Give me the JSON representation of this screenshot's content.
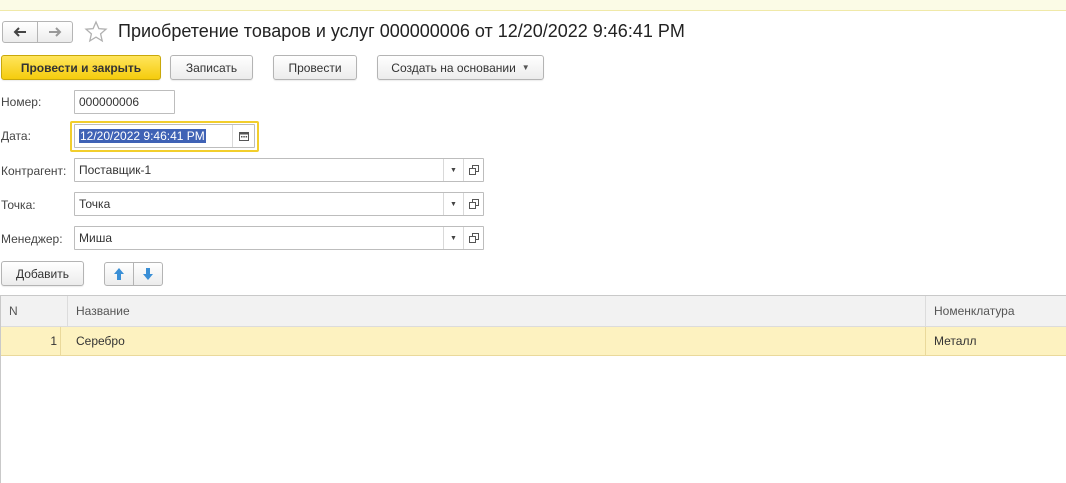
{
  "window": {
    "title": "Приобретение товаров и услуг 000000006 от 12/20/2022 9:46:41 PM"
  },
  "toolbar": {
    "post_and_close": "Провести и закрыть",
    "write": "Записать",
    "post": "Провести",
    "create_based_on": "Создать на основании"
  },
  "form": {
    "number_label": "Номер:",
    "number_value": "000000006",
    "date_label": "Дата:",
    "date_value": "12/20/2022  9:46:41 PM",
    "counterparty_label": "Контрагент:",
    "counterparty_value": "Поставщик-1",
    "point_label": "Точка:",
    "point_value": "Точка",
    "manager_label": "Менеджер:",
    "manager_value": "Миша"
  },
  "table_toolbar": {
    "add": "Добавить"
  },
  "table": {
    "columns": [
      "N",
      "Название",
      "Номенклатура"
    ],
    "rows": [
      {
        "n": "1",
        "name": "Серебро",
        "nomenclature": "Металл"
      }
    ]
  },
  "colors": {
    "primary_button": "#f5cc0d",
    "focus_border": "#f2ce2c",
    "selected_row": "#fdf2c0",
    "text_selection": "#3f62b5",
    "arrow_blue": "#3a8fd6"
  },
  "icons": [
    "back-arrow-icon",
    "forward-arrow-icon",
    "star-icon",
    "calendar-icon",
    "dropdown-icon",
    "open-icon",
    "move-up-icon",
    "move-down-icon"
  ]
}
